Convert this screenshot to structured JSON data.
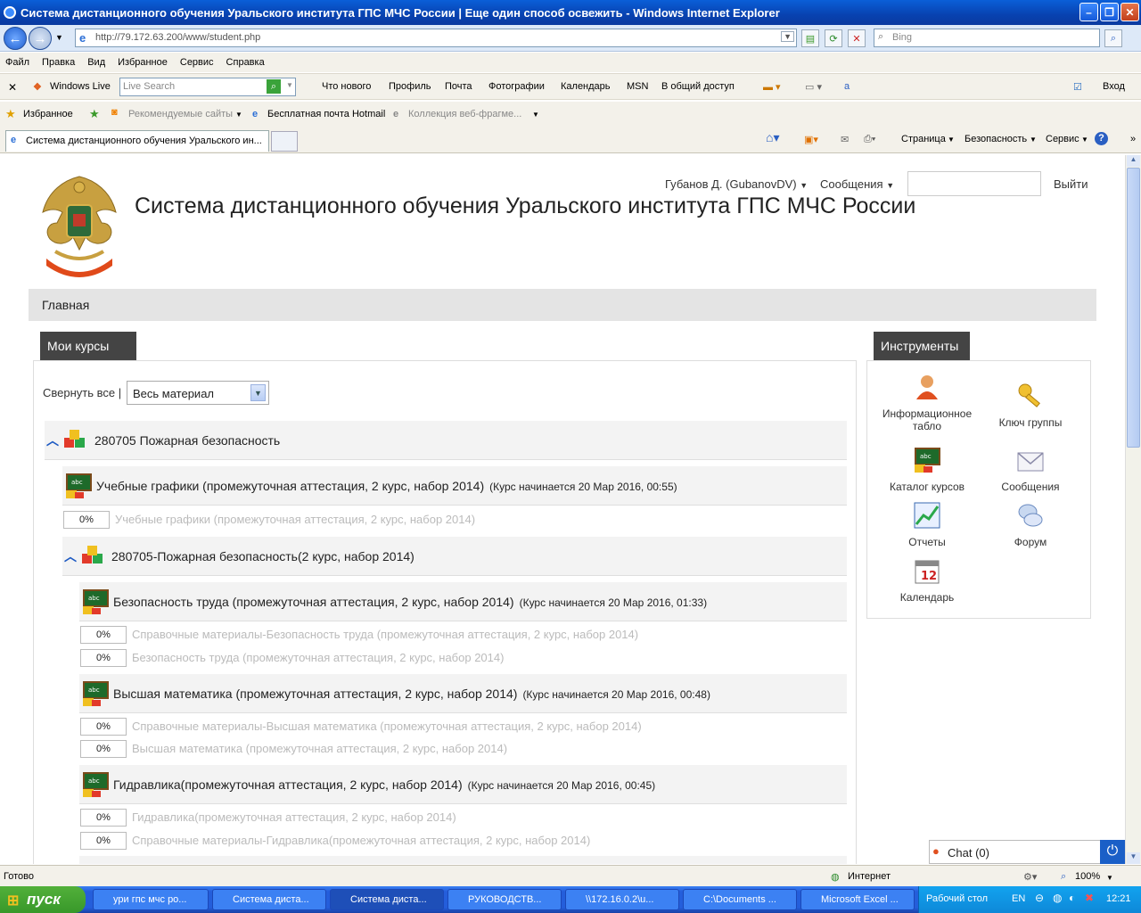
{
  "window": {
    "title": "Система дистанционного обучения Уральского института ГПС МЧС России | Еще один способ освежить  - Windows Internet Explorer",
    "address": "http://79.172.63.200/www/student.php",
    "search_placeholder": "Bing"
  },
  "menu": [
    "Файл",
    "Правка",
    "Вид",
    "Избранное",
    "Сервис",
    "Справка"
  ],
  "live_toolbar": {
    "brand": "Windows Live",
    "search_placeholder": "Live Search",
    "links": [
      "Что нового",
      "Профиль",
      "Почта",
      "Фотографии",
      "Календарь",
      "MSN",
      "В общий доступ"
    ],
    "signin": "Вход"
  },
  "favorites_bar": {
    "favorites": "Избранное",
    "items": [
      "Рекомендуемые сайты",
      "Бесплатная почта Hotmail",
      "Коллекция веб-фрагме..."
    ]
  },
  "tabs": {
    "active": "Система дистанционного обучения Уральского ин...",
    "commands": [
      "Страница",
      "Безопасность",
      "Сервис"
    ]
  },
  "page": {
    "site_title": "Система дистанционного обучения Уральского института ГПС МЧС России",
    "user": "Губанов Д. (GubanovDV)",
    "messages": "Сообщения",
    "logout": "Выйти",
    "nav_home": "Главная",
    "my_courses_header": "Мои курсы",
    "tools_header": "Инструменты",
    "collapse_all": "Свернуть все |",
    "filter_value": "Весь материал",
    "courses": [
      {
        "title": "280705 Пожарная безопасность"
      },
      {
        "title": "Учебные графики (промежуточная аттестация, 2 курс, набор 2014)",
        "note": "(Курс начинается 20 Мар 2016, 00:55)",
        "materials": [
          {
            "progress": "0%",
            "title": "Учебные графики (промежуточная аттестация, 2 курс, набор 2014)"
          }
        ]
      },
      {
        "title": "280705-Пожарная безопасность(2 курс, набор 2014)"
      },
      {
        "title": "Безопасность труда (промежуточная аттестация, 2 курс, набор 2014)",
        "note": "(Курс начинается 20 Мар 2016, 01:33)",
        "materials": [
          {
            "progress": "0%",
            "title": "Справочные материалы-Безопасность труда (промежуточная аттестация, 2 курс, набор 2014)"
          },
          {
            "progress": "0%",
            "title": "Безопасность труда (промежуточная аттестация, 2 курс, набор 2014)"
          }
        ]
      },
      {
        "title": "Высшая математика (промежуточная аттестация, 2 курс, набор 2014)",
        "note": "(Курс начинается 20 Мар 2016, 00:48)",
        "materials": [
          {
            "progress": "0%",
            "title": "Справочные материалы-Высшая математика (промежуточная аттестация, 2 курс, набор 2014)"
          },
          {
            "progress": "0%",
            "title": "Высшая математика (промежуточная аттестация, 2 курс, набор 2014)"
          }
        ]
      },
      {
        "title": "Гидравлика(промежуточная аттестация, 2 курс, набор 2014)",
        "note": "(Курс начинается 20 Мар 2016, 00:45)",
        "materials": [
          {
            "progress": "0%",
            "title": "Гидравлика(промежуточная аттестация, 2 курс, набор 2014)"
          },
          {
            "progress": "0%",
            "title": "Справочные материалы-Гидравлика(промежуточная аттестация, 2 курс, набор 2014)"
          }
        ]
      }
    ],
    "tools": {
      "info_board": "Информационное табло",
      "group_key": "Ключ группы",
      "catalog": "Каталог курсов",
      "messages": "Сообщения",
      "reports": "Отчеты",
      "forum": "Форум",
      "calendar": "Календарь",
      "calendar_day": "12"
    },
    "chat": "Chat (0)"
  },
  "statusbar": {
    "left": "Готово",
    "zone": "Интернет",
    "zoom": "100%"
  },
  "taskbar": {
    "start": "пуск",
    "buttons": [
      "ури гпс мчс ро...",
      "Система диста...",
      "Система диста...",
      "РУКОВОДСТВ...",
      "\\\\172.16.0.2\\u...",
      "C:\\Documents ...",
      "Microsoft Excel ..."
    ],
    "desktop": "Рабочий стол",
    "lang": "EN",
    "clock": "12:21"
  },
  "colors": {
    "titlebar": "#0842b0",
    "block_header": "#444444",
    "taskbar": "#245edb",
    "start": "#38982a"
  }
}
